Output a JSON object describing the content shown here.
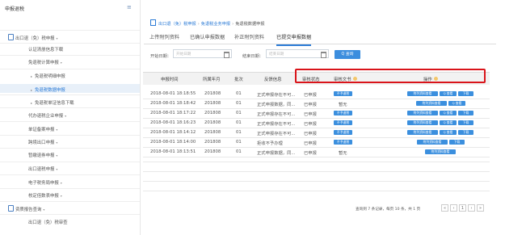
{
  "sidebar": {
    "title": "申报退税",
    "sections": [
      {
        "label": "出口退（免）税申报",
        "caret": "▾"
      },
      {
        "label": "认证清册信息下载"
      },
      {
        "label": "免退税计算申报",
        "caret": "▾"
      },
      {
        "label": "免退税明细申报"
      },
      {
        "label": "免退税数据申报",
        "active": true
      },
      {
        "label": "免退税单证信息下载"
      },
      {
        "label": "代办退税企业申报",
        "caret": "▾"
      },
      {
        "label": "单证备案申报",
        "caret": "▾"
      },
      {
        "label": "跨境出口申报",
        "caret": "▾"
      },
      {
        "label": "暂缴退券申报",
        "caret": "▾"
      },
      {
        "label": "出口退税申报",
        "caret": "▾"
      },
      {
        "label": "电子税务局申报",
        "caret": "▾"
      },
      {
        "label": "核定倍数表申报",
        "caret": "▾"
      },
      {
        "label": "资质报告查询",
        "caret": "▾"
      },
      {
        "label": "出口退（免）税审查"
      }
    ]
  },
  "breadcrumb": [
    "出口退（免）税申报",
    "免退税业务申报",
    "免退税数据申报"
  ],
  "tabs": [
    "上传附列资料",
    "已确认申报数据",
    "补正附列资料",
    "已提交申报数据"
  ],
  "filter": {
    "start_label": "开始日期：",
    "start_placeholder": "开始日期",
    "end_label": "结束日期：",
    "end_placeholder": "结束日期",
    "query_button": "Q 查询"
  },
  "table": {
    "headers": [
      "申报时间",
      "所属年月",
      "批次",
      "反馈信息",
      "审核状态",
      "审核文书",
      "操作"
    ],
    "rows": [
      {
        "time": "2018-08-01 18:18:55",
        "ym": "201808",
        "batch": "01",
        "feedback": "正式申报存在不可...",
        "status": "已申报",
        "doc": "不予退税",
        "ops": [
          "附列资料查看",
          "Q 查看",
          "下载"
        ]
      },
      {
        "time": "2018-08-01 18:18:42",
        "ym": "201808",
        "batch": "01",
        "feedback": "正式申报数据，同...",
        "status": "已申报",
        "doc": "暂无",
        "ops": [
          "附列资料查看",
          "Q 查看"
        ]
      },
      {
        "time": "2018-08-01 18:17:22",
        "ym": "201808",
        "batch": "01",
        "feedback": "正式申报存在不可...",
        "status": "已申报",
        "doc": "不予退税",
        "ops": [
          "附列资料查看",
          "Q 查看",
          "下载"
        ]
      },
      {
        "time": "2018-08-01 18:16:23",
        "ym": "201808",
        "batch": "01",
        "feedback": "正式申报存在不可...",
        "status": "已申报",
        "doc": "不予退税",
        "ops": [
          "附列资料查看",
          "Q 查看",
          "下载"
        ]
      },
      {
        "time": "2018-08-01 18:14:12",
        "ym": "201808",
        "batch": "01",
        "feedback": "正式申报存在不可...",
        "status": "已申报",
        "doc": "不予退税",
        "ops": [
          "附列资料查看",
          "Q 查看",
          "下载"
        ]
      },
      {
        "time": "2018-08-01 18:14:00",
        "ym": "201808",
        "batch": "01",
        "feedback": "拒收不予办理",
        "status": "已申报",
        "doc": "不予退税",
        "ops": [
          "附列资料查看",
          "下载"
        ]
      },
      {
        "time": "2018-08-01 18:13:51",
        "ym": "201808",
        "batch": "01",
        "feedback": "正式申报数据，同...",
        "status": "已申报",
        "doc": "暂无",
        "ops": [
          "附列资料查看"
        ]
      }
    ]
  },
  "pager": {
    "summary": "查询到 7 条记录，每页 10 条，共 1 页",
    "first": "«",
    "prev": "‹",
    "page": "1",
    "next": "›",
    "last": "»"
  }
}
